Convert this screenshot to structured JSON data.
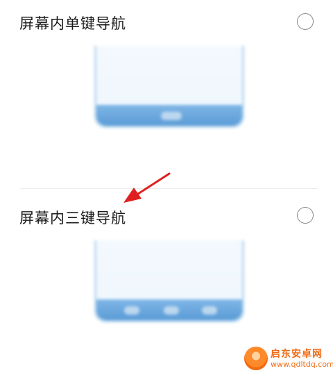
{
  "options": [
    {
      "label": "屏幕内单键导航",
      "selected": false
    },
    {
      "label": "屏幕内三键导航",
      "selected": false
    }
  ],
  "watermark": {
    "brand": "启东安卓网",
    "url": "www.qdltdq.com"
  },
  "colors": {
    "preview_bar": "#5a9bd6",
    "preview_border": "#b9d8ef",
    "arrow": "#e02020",
    "watermark": "#ef6b16"
  }
}
